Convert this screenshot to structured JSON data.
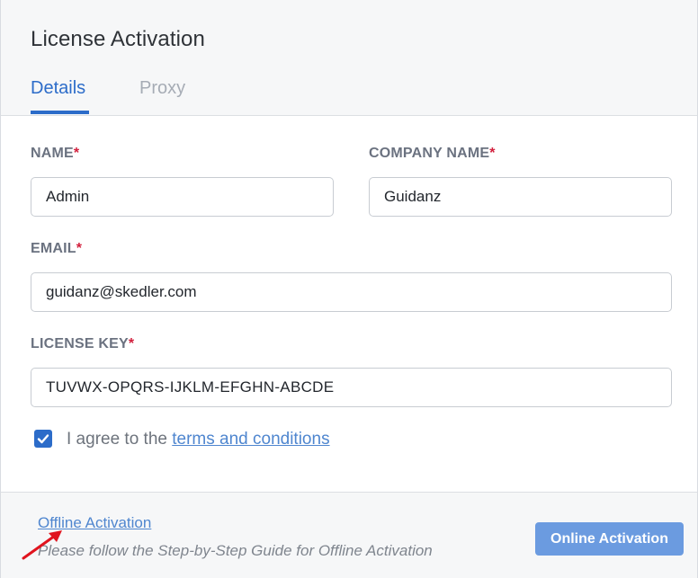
{
  "dialog": {
    "title": "License Activation",
    "tabs": [
      {
        "label": "Details",
        "active": true
      },
      {
        "label": "Proxy",
        "active": false
      }
    ]
  },
  "form": {
    "name": {
      "label": "NAME",
      "required_mark": "*",
      "value": "Admin"
    },
    "company": {
      "label": "COMPANY NAME",
      "required_mark": "*",
      "value": "Guidanz"
    },
    "email": {
      "label": "EMAIL",
      "required_mark": "*",
      "value": "guidanz@skedler.com"
    },
    "license_key": {
      "label": "LICENSE KEY",
      "required_mark": "*",
      "value": "TUVWX-OPQRS-IJKLM-EFGHN-ABCDE"
    },
    "agree": {
      "checked": true,
      "text": "I agree to the ",
      "link": "terms and conditions"
    }
  },
  "footer": {
    "offline_link": "Offline Activation",
    "guide_text": "Please follow the Step-by-Step Guide for Offline Activation",
    "online_button": "Online Activation"
  },
  "colors": {
    "accent": "#2c6cc9",
    "link": "#4f86cf",
    "required": "#d21f3c",
    "button": "#6b9be0",
    "annotation_arrow": "#e0141e"
  },
  "icons": {
    "checkbox": "checkmark-icon",
    "annotation": "red-arrow-icon"
  }
}
